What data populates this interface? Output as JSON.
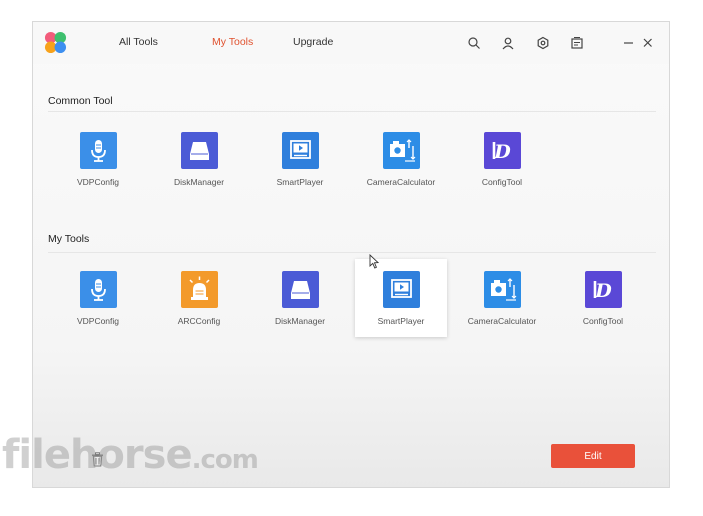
{
  "nav": {
    "tabs": [
      {
        "label": "All Tools"
      },
      {
        "label": "My Tools"
      },
      {
        "label": "Upgrade"
      }
    ],
    "active_tab": "My Tools"
  },
  "toolbar_icons": [
    "search-icon",
    "user-icon",
    "settings-icon",
    "message-icon",
    "minimize-icon",
    "close-icon"
  ],
  "common_tool": {
    "title": "Common Tool",
    "items": [
      {
        "label": "VDPConfig",
        "icon": "microphone-icon",
        "color": "#3b8fe8"
      },
      {
        "label": "DiskManager",
        "icon": "disk-icon",
        "color": "#4b5bd6"
      },
      {
        "label": "SmartPlayer",
        "icon": "player-icon",
        "color": "#2f7fdc"
      },
      {
        "label": "CameraCalculator",
        "icon": "camera-calculator-icon",
        "color": "#2d8de6"
      },
      {
        "label": "ConfigTool",
        "icon": "configtool-icon",
        "color": "#5a48d6"
      }
    ]
  },
  "my_tools": {
    "title": "My Tools",
    "items": [
      {
        "label": "VDPConfig",
        "icon": "microphone-icon",
        "color": "#3b8fe8"
      },
      {
        "label": "ARCConfig",
        "icon": "alarm-icon",
        "color": "#f39a2b"
      },
      {
        "label": "DiskManager",
        "icon": "disk-icon",
        "color": "#4b5bd6"
      },
      {
        "label": "SmartPlayer",
        "icon": "player-icon",
        "color": "#2f7fdc"
      },
      {
        "label": "CameraCalculator",
        "icon": "camera-calculator-icon",
        "color": "#2d8de6"
      },
      {
        "label": "ConfigTool",
        "icon": "configtool-icon",
        "color": "#5a48d6"
      }
    ]
  },
  "footer": {
    "edit_label": "Edit",
    "edit_color": "#e9513a"
  },
  "watermark": {
    "text": "filehorse",
    "suffix": ".com"
  },
  "accent_color": "#e0522f"
}
